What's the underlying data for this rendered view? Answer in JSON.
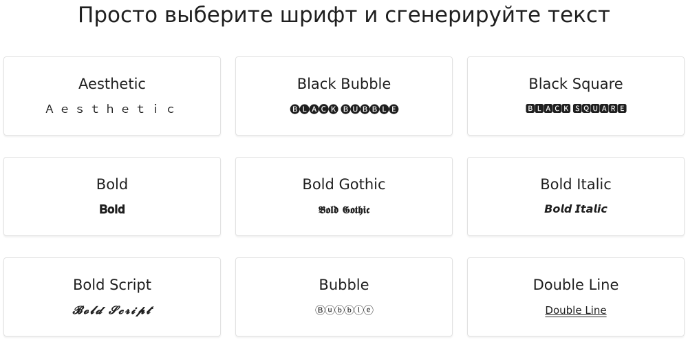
{
  "heading": "Просто выберите шрифт и сгенерируйте текст",
  "fonts": [
    {
      "title": "Aesthetic",
      "sample": "Ａｅｓｔｈｅｔｉｃ"
    },
    {
      "title": "Black Bubble",
      "sample": "🅑🅛🅐🅒🅚 🅑🅤🅑🅑🅛🅔"
    },
    {
      "title": "Black Square",
      "sample": "🅱🅻🅰🅲🅺 🆂🆀🆄🅰🆁🅴"
    },
    {
      "title": "Bold",
      "sample": "𝐁𝐨𝐥𝐝"
    },
    {
      "title": "Bold Gothic",
      "sample": "𝕭𝖔𝖑𝖉 𝕲𝖔𝖙𝖍𝖎𝖈"
    },
    {
      "title": "Bold Italic",
      "sample": "𝘽𝙤𝙡𝙙 𝙄𝙩𝙖𝙡𝙞𝙘"
    },
    {
      "title": "Bold Script",
      "sample": "𝓑𝓸𝓵𝓭 𝓢𝓬𝓻𝓲𝓹𝓽"
    },
    {
      "title": "Bubble",
      "sample": "Ⓑⓤⓑⓑⓛⓔ"
    },
    {
      "title": "Double Line",
      "sample": "Double Line"
    }
  ]
}
